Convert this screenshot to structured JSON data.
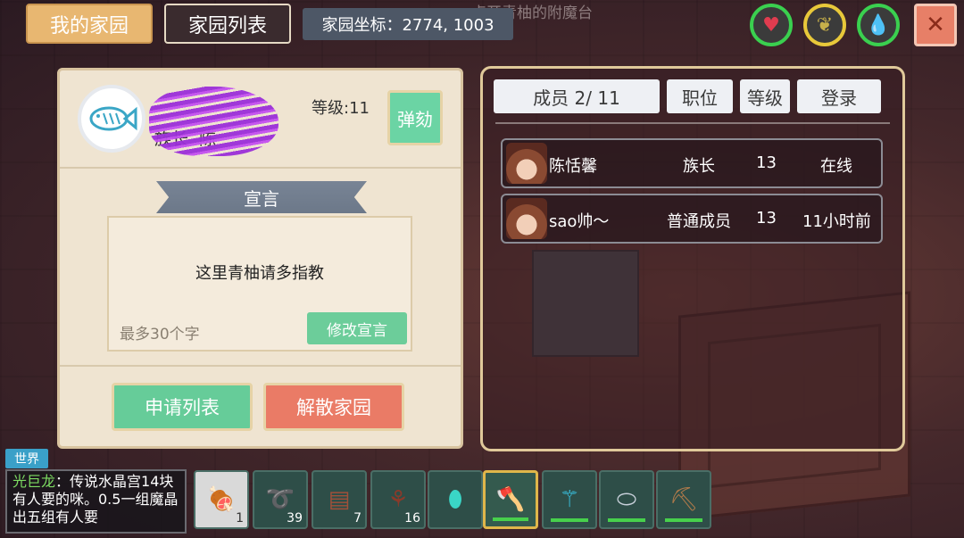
{
  "tabs": {
    "my_home": "我的家园",
    "home_list": "家园列表"
  },
  "coords": "家园坐标：2774, 1003",
  "overhead_text": "点开青柚的附魔台",
  "stats": [
    {
      "name": "health",
      "icon": "♥",
      "color": "#e03c4f",
      "ring": "#3ad04f"
    },
    {
      "name": "hunger",
      "icon": "❦",
      "color": "#c7b04a",
      "ring": "#e8c83a"
    },
    {
      "name": "water",
      "icon": "💧",
      "color": "#3ac6e6",
      "ring": "#3ad04f"
    }
  ],
  "close_icon": "✕",
  "home": {
    "leader_label": "族长",
    "leader_name": "陈",
    "level": "等级:11",
    "impeach": "弹劾",
    "declaration_title": "宣言",
    "declaration_text": "这里青柚请多指教",
    "declaration_hint": "最多30个字",
    "edit_declaration": "修改宣言",
    "apply_list": "申请列表",
    "dissolve": "解散家园"
  },
  "members": {
    "headers": [
      "成员 2/ 11",
      "职位",
      "等级",
      "登录"
    ],
    "rows": [
      {
        "name": "陈恬馨",
        "role": "族长",
        "level": "13",
        "login": "在线"
      },
      {
        "name": "sao帅～",
        "role": "普通成员",
        "level": "13",
        "login": "11小时前"
      }
    ]
  },
  "chat": {
    "channel": "世界",
    "speaker": "光巨龙",
    "message": "：传说水晶宫14块有人要的咪。0.5一组魔晶出五组有人要"
  },
  "hotbar": [
    {
      "icon": "meat-icon",
      "glyph": "🍖",
      "count": "1"
    },
    {
      "icon": "rope-icon",
      "glyph": "➰",
      "count": "39"
    },
    {
      "icon": "leather-icon",
      "glyph": "▤",
      "count": "7"
    },
    {
      "icon": "vine-icon",
      "glyph": "⚘",
      "count": "16"
    },
    {
      "icon": "crystal-icon",
      "glyph": "⬮",
      "count": ""
    },
    {
      "icon": "axe-icon",
      "glyph": "🪓",
      "count": "",
      "selected": true,
      "durability": true
    },
    {
      "icon": "staff-icon",
      "glyph": "⚚",
      "count": "",
      "durability": true
    },
    {
      "icon": "shield-icon",
      "glyph": "⬭",
      "count": "",
      "durability": true
    },
    {
      "icon": "pickaxe-icon",
      "glyph": "⛏",
      "count": "",
      "durability": true
    }
  ]
}
